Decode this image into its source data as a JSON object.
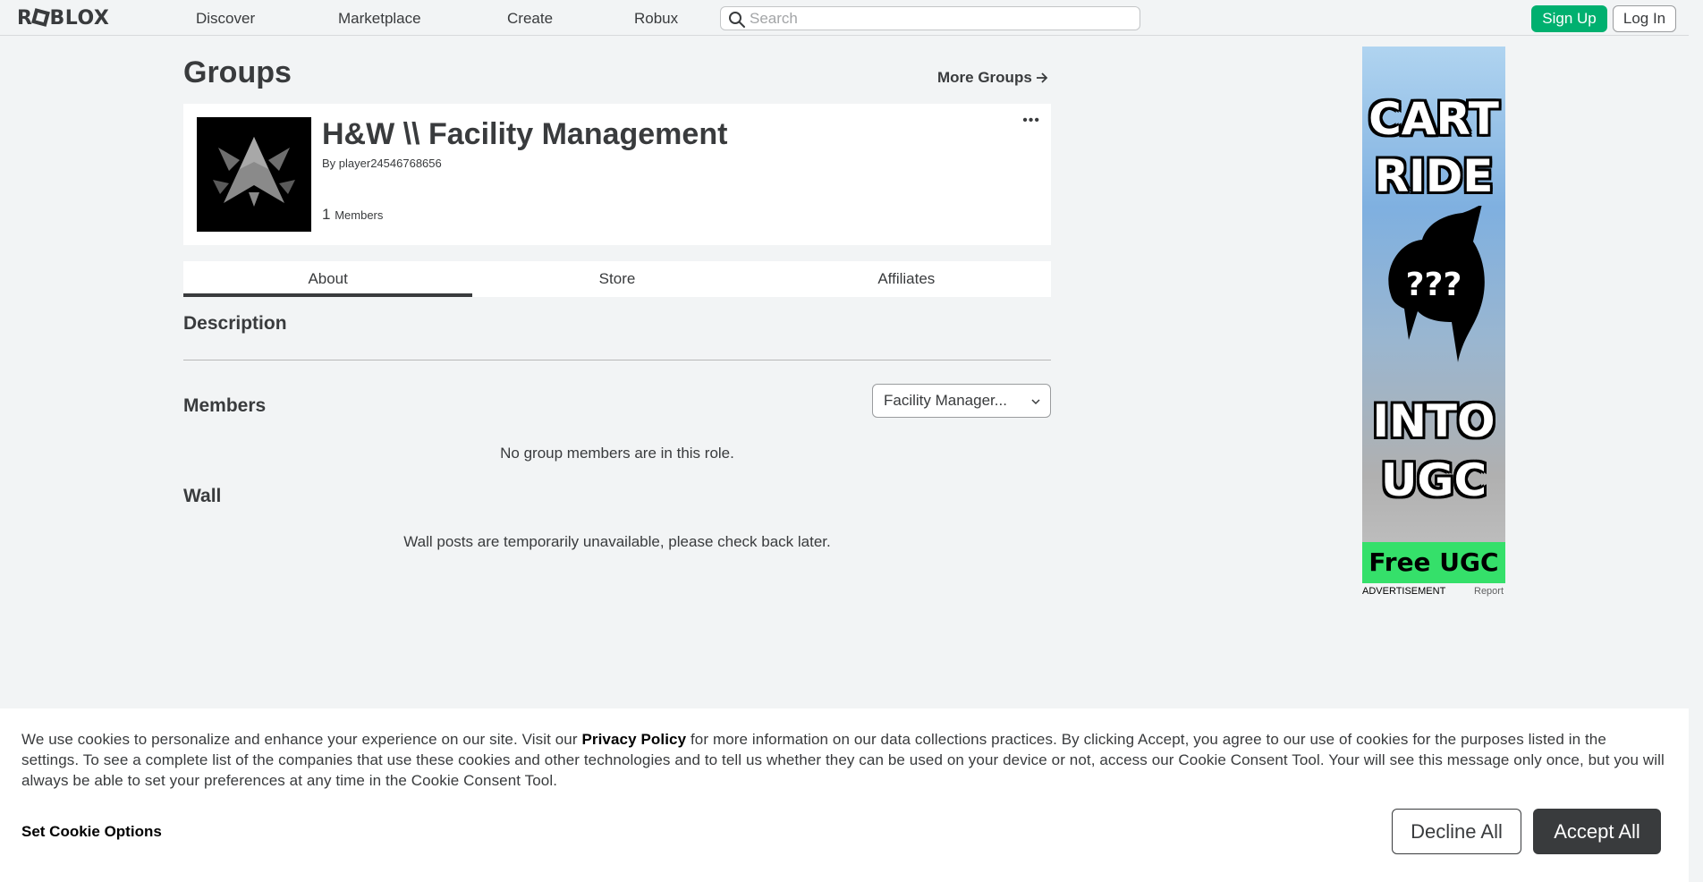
{
  "nav": {
    "logo_pre": "R",
    "logo_post": "BLOX",
    "links": [
      "Discover",
      "Marketplace",
      "Create",
      "Robux"
    ],
    "search_placeholder": "Search",
    "signup_label": "Sign Up",
    "login_label": "Log In"
  },
  "page": {
    "title": "Groups",
    "more_groups_label": "More Groups"
  },
  "group": {
    "name": "H&W \\\\ Facility Management",
    "owner_prefix": "By",
    "owner_name": "player24546768656",
    "member_count": "1",
    "member_label": "Members",
    "menu_dots": "•••"
  },
  "tabs": [
    "About",
    "Store",
    "Affiliates"
  ],
  "about": {
    "description_title": "Description",
    "members_title": "Members",
    "role_selected": "Facility Manager...",
    "members_empty": "No group members are in this role.",
    "wall_title": "Wall",
    "wall_message": "Wall posts are temporarily unavailable, please check back later."
  },
  "ad": {
    "line1": "CART",
    "line2": "RIDE",
    "mystery": "???",
    "line3": "INTO",
    "line4": "UGC",
    "banner": "Free UGC !",
    "label": "ADVERTISEMENT",
    "report": "Report"
  },
  "cookie": {
    "text_before": "We use cookies to personalize and enhance your experience on our site. Visit our ",
    "privacy_link": "Privacy Policy",
    "text_after": " for more information on our data collections practices. By clicking Accept, you agree to our use of cookies for the purposes listed in the settings. To see a complete list of the companies that use these cookies and other technologies and to tell us whether they can be used on your device or not, access our Cookie Consent Tool. Your will see this message only once, but you will always be able to set your preferences at any time in the Cookie Consent Tool.",
    "options_label": "Set Cookie Options",
    "decline_label": "Decline All",
    "accept_label": "Accept All"
  },
  "colors": {
    "signup_green": "#00b06f",
    "text_dark": "#393b3d",
    "page_bg": "#f2f4f5"
  }
}
